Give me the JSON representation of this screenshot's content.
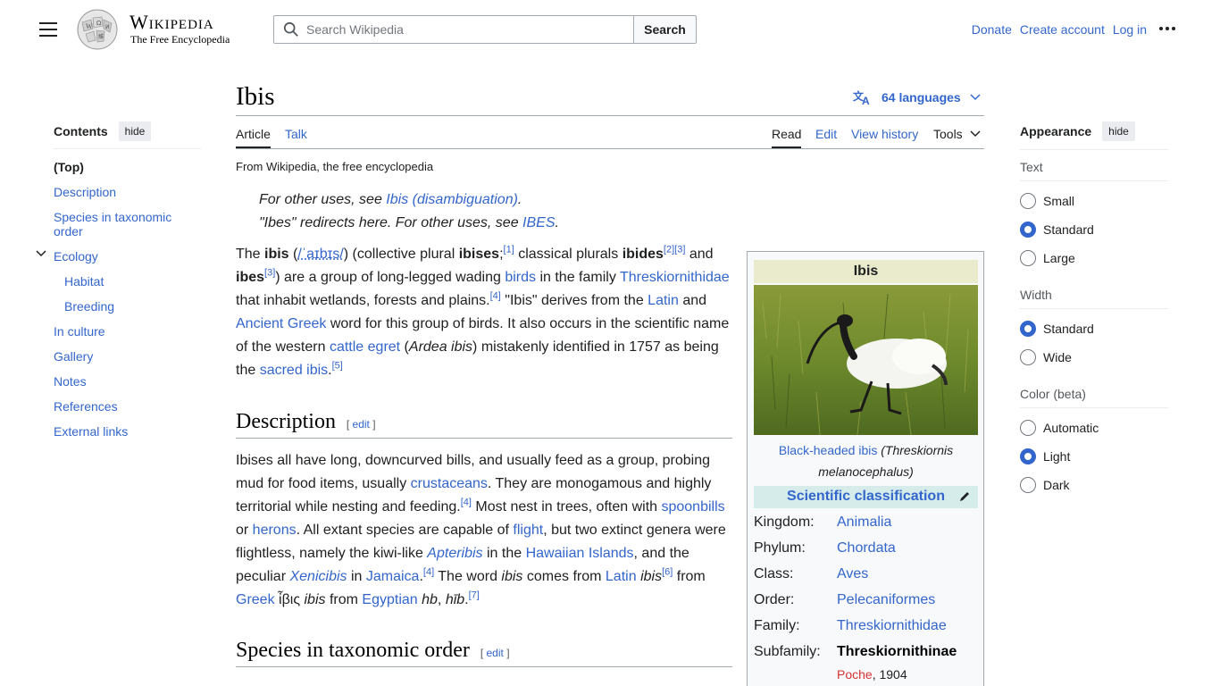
{
  "header": {
    "wordmark": "Wikipedia",
    "tagline": "The Free Encyclopedia",
    "search_placeholder": "Search Wikipedia",
    "search_button": "Search",
    "links": [
      "Donate",
      "Create account",
      "Log in"
    ]
  },
  "toc": {
    "title": "Contents",
    "hide": "hide",
    "items": [
      "(Top)",
      "Description",
      "Species in taxonomic order",
      "Ecology",
      "Habitat",
      "Breeding",
      "In culture",
      "Gallery",
      "Notes",
      "References",
      "External links"
    ]
  },
  "page": {
    "title": "Ibis",
    "languages": "64 languages",
    "tabs": {
      "article": "Article",
      "talk": "Talk",
      "read": "Read",
      "edit": "Edit",
      "history": "View history",
      "tools": "Tools"
    },
    "from": "From Wikipedia, the free encyclopedia"
  },
  "hatnotes": {
    "h1_prefix": "For other uses, see ",
    "h1_link": "Ibis (disambiguation)",
    "h1_suffix": ".",
    "h2_prefix": "\"Ibes\" redirects here. For other uses, see ",
    "h2_link": "IBES",
    "h2_suffix": "."
  },
  "intro": {
    "t1": "The ",
    "b1": "ibis",
    "t2": " (",
    "ipa": "/ˈaɪbɪs/",
    "t3": ") (collective plural ",
    "b2": "ibises",
    "t4": ";",
    "r1": "[1]",
    "t5": " classical plurals ",
    "b3": "ibides",
    "r2": "[2]",
    "r3": "[3]",
    "t6": " and",
    "b4": "ibes",
    "r4": "[3]",
    "t7": ") are a group of long-legged wading ",
    "l1": "birds",
    "t8": " in the family ",
    "l2": "Threskiornithidae",
    "t9": "that inhabit wetlands, forests and plains.",
    "r5": "[4]",
    "t10": " \"Ibis\" derives from the ",
    "l3": "Latin",
    "t11": " and",
    "l4": "Ancient Greek",
    "t12": " word for this group of birds. It also occurs in the scientific name",
    "t13": "of the western ",
    "l5": "cattle egret",
    "t14": " (",
    "i1": "Ardea ibis",
    "t15": ") mistakenly identified in 1757 as being",
    "t16": "the ",
    "l6": "sacred ibis",
    "t17": ".",
    "r6": "[5]"
  },
  "description": {
    "heading": "Description",
    "edit": "edit",
    "t1": "Ibises all have long, downcurved bills, and usually feed as a group, probing",
    "t2": "mud for food items, usually ",
    "l1": "crustaceans",
    "t3": ". They are monogamous and highly",
    "t4": "territorial while nesting and feeding.",
    "r1": "[4]",
    "t5": " Most nest in trees, often with ",
    "l2": "spoonbills",
    "t6": "or ",
    "l3": "herons",
    "t7": ". All extant species are capable of ",
    "l4": "flight",
    "t8": ", but two extinct genera were",
    "t9": "flightless, namely the kiwi-like ",
    "l5": "Apteribis",
    "t10": " in the ",
    "l6": "Hawaiian Islands",
    "t11": ", and the",
    "t12": "peculiar ",
    "l7": "Xenicibis",
    "t13": " in ",
    "l8": "Jamaica",
    "t14": ".",
    "r2": "[4]",
    "t15": " The word ",
    "i1": "ibis",
    "t16": " comes from ",
    "l9": "Latin",
    "t17": " ",
    "i2": "ibis",
    "r3": "[6]",
    "t18": " from",
    "l10": "Greek",
    "t19": " ἶβις ",
    "i3": "ibis",
    "t20": " from ",
    "l11": "Egyptian",
    "t21": " ",
    "i4": "hb",
    "t22": ", ",
    "i5": "hīb",
    "t23": ".",
    "r4": "[7]"
  },
  "species": {
    "heading": "Species in taxonomic order",
    "edit": "edit"
  },
  "infobox": {
    "title": "Ibis",
    "caption_link": "Black-headed ibis",
    "caption_italic1": "(Threskiornis",
    "caption_italic2": "melanocephalus)",
    "sci_class": "Scientific classification",
    "rows": [
      {
        "k": "Kingdom:",
        "v": "Animalia"
      },
      {
        "k": "Phylum:",
        "v": "Chordata"
      },
      {
        "k": "Class:",
        "v": "Aves"
      },
      {
        "k": "Order:",
        "v": "Pelecaniformes"
      },
      {
        "k": "Family:",
        "v": "Threskiornithidae"
      },
      {
        "k": "Subfamily:",
        "v": "Threskiornithinae"
      }
    ],
    "authority_name": "Poche",
    "authority_year": ", 1904"
  },
  "appearance": {
    "title": "Appearance",
    "hide": "hide",
    "text_label": "Text",
    "text_options": [
      "Small",
      "Standard",
      "Large"
    ],
    "text_selected": "Standard",
    "width_label": "Width",
    "width_options": [
      "Standard",
      "Wide"
    ],
    "width_selected": "Standard",
    "color_label": "Color (beta)",
    "color_options": [
      "Automatic",
      "Light",
      "Dark"
    ],
    "color_selected": "Light"
  },
  "colors": {
    "link": "#3366cc",
    "redlink": "#d73333",
    "infobox_title_bg": "#eaeacc",
    "infobox_sci_bg": "#d6eceb"
  },
  "icons": [
    "menu-icon",
    "wikipedia-globe-logo",
    "search-icon",
    "ellipsis-icon",
    "chevron-down-icon",
    "translate-icon",
    "pencil-icon"
  ]
}
